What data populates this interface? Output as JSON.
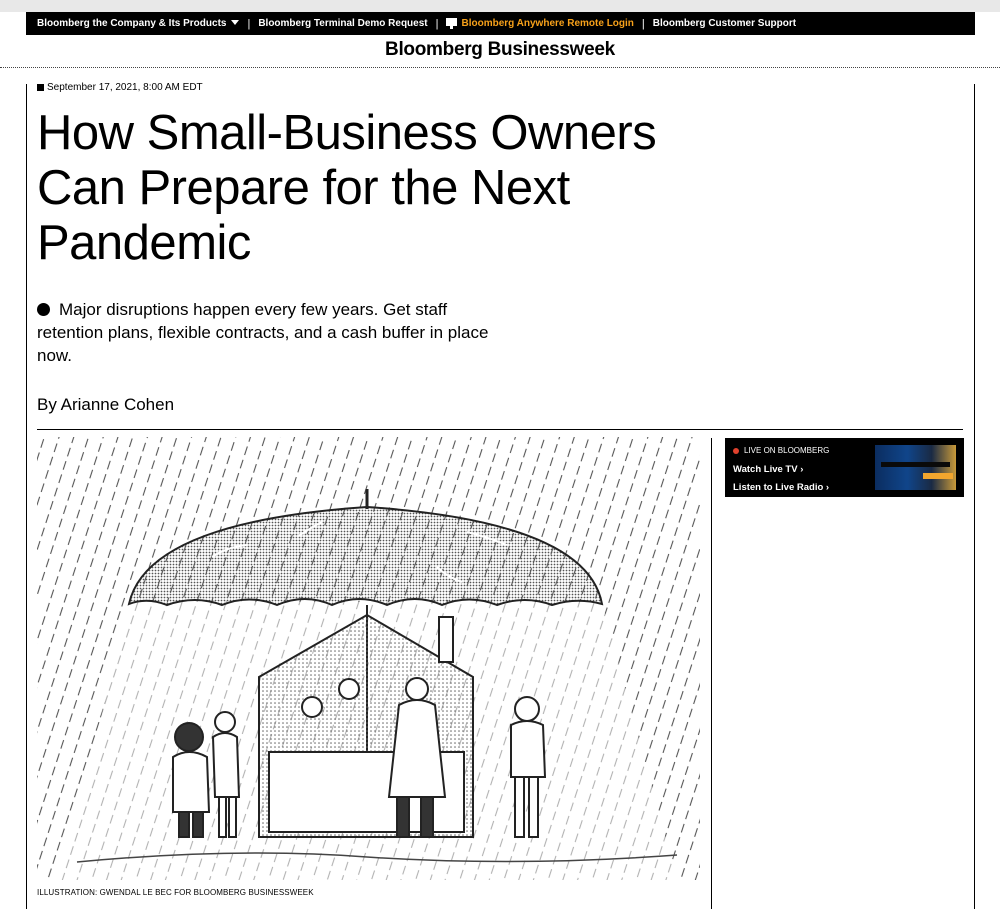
{
  "topnav": {
    "items": [
      {
        "label": "Bloomberg the Company & Its Products"
      },
      {
        "label": "Bloomberg Terminal Demo Request"
      },
      {
        "label": "Bloomberg Anywhere Remote Login"
      },
      {
        "label": "Bloomberg Customer Support"
      }
    ],
    "accent_color": "#f7a11a"
  },
  "brand": {
    "title": "Bloomberg Businessweek"
  },
  "article": {
    "date": "September 17, 2021, 8:00 AM EDT",
    "headline": "How Small-Business Owners Can Prepare for the Next Pandemic",
    "abstract": "Major disruptions happen every few years. Get staff retention plans, flexible contracts, and a cash buffer in place now.",
    "byline": "By Arianne Cohen",
    "image_credit": "ILLUSTRATION: GWENDAL LE BEC FOR BLOOMBERG BUSINESSWEEK"
  },
  "live": {
    "label": "LIVE ON BLOOMBERG",
    "watch": "Watch Live TV",
    "listen": "Listen to Live Radio",
    "dot_color": "#e0412d"
  }
}
